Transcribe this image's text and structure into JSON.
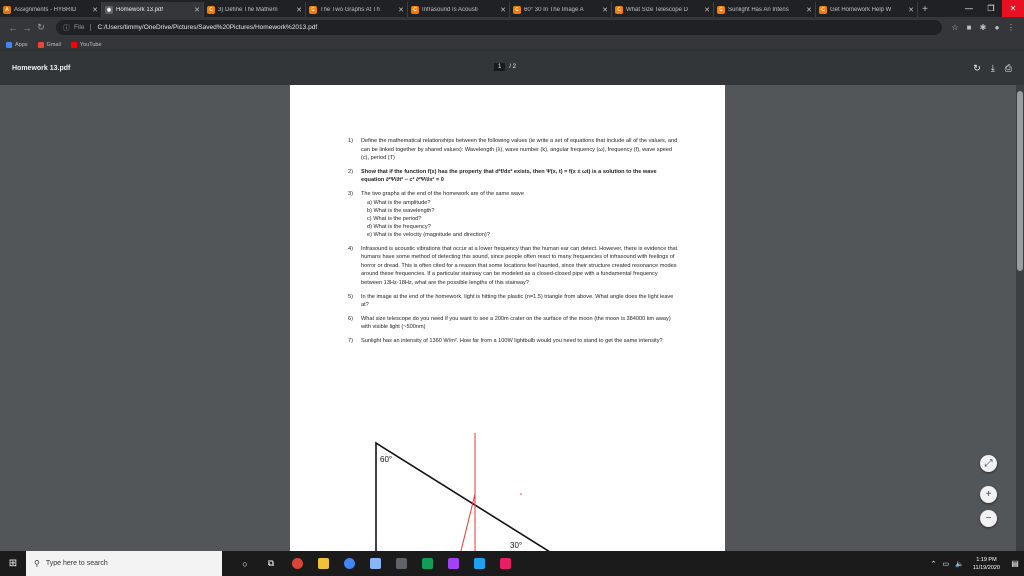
{
  "browser": {
    "tabs": [
      {
        "label": "Assignments - HYBRID",
        "color": "#e37400",
        "glyph": "A",
        "active": false
      },
      {
        "label": "Homework 13.pdf",
        "color": "#5f6368",
        "glyph": "◉",
        "active": true
      },
      {
        "label": "3) Define The Mathem",
        "color": "#f57c00",
        "glyph": "C",
        "active": false
      },
      {
        "label": "The Two Graphs At Th",
        "color": "#f57c00",
        "glyph": "C",
        "active": false
      },
      {
        "label": "Infrasound Is Acousti",
        "color": "#f57c00",
        "glyph": "C",
        "active": false
      },
      {
        "label": "60° 30 In The Image A",
        "color": "#f57c00",
        "glyph": "C",
        "active": false
      },
      {
        "label": "What Size Telescope D",
        "color": "#f57c00",
        "glyph": "C",
        "active": false
      },
      {
        "label": "Sunlight Has An Intens",
        "color": "#f57c00",
        "glyph": "C",
        "active": false
      },
      {
        "label": "Get Homework Help W",
        "color": "#f57c00",
        "glyph": "C",
        "active": false
      }
    ],
    "new_tab": "+",
    "window_controls": {
      "minimize": "—",
      "restore": "❐",
      "close": "✕"
    },
    "address": {
      "scheme": "File",
      "url": "C:/Users/timmy/OneDrive/Pictures/Saved%20Pictures/Homework%2013.pdf"
    },
    "bookmarks": [
      {
        "label": "Apps",
        "color": "#4285f4"
      },
      {
        "label": "Gmail",
        "color": "#ea4335"
      },
      {
        "label": "YouTube",
        "color": "#ff0000"
      }
    ]
  },
  "pdf": {
    "filename": "Homework 13.pdf",
    "page_current": "1",
    "page_total": "/ 2",
    "questions": [
      {
        "n": "1)",
        "text": "Define the mathematical relationships between the following values (ie write a set of equations that include all of the values, and can be linked together by shared values): Wavelength (λ), wave number (k), angular frequency (ω), frequency (f), wave speed (c), period (T)"
      },
      {
        "n": "2)",
        "text": "Show that if the function f(x) has the property that d²f/dx² exists, then Ψ(x, t) = f(x ± ωt) is a solution to the wave equation ∂²Ψ/∂t² − c² ∂²Ψ/∂x² = 0",
        "bold": true
      },
      {
        "n": "3)",
        "text": "The two graphs at the end of the homework are of the same wave",
        "sub": [
          "a)  What is the amplitude?",
          "b)  What is the wavelength?",
          "c)  What is the period?",
          "d)  What is the frequency?",
          "e)  What is the velocity (magnitude and direction)?"
        ]
      },
      {
        "n": "4)",
        "text": "Infrasound is acoustic vibrations that occur at a lower frequency than the human ear can detect. However, there is evidence that humans have some method of detecting this sound, since people often react to many frequencies of infrasound with feelings of horror or dread. This is often cited for a reason that some locations feel haunted, since their structure created resonance modes around these frequencies. If a particular stairway can be modeled as a closed-closed pipe with a fundamental frequency between 13Hz-18Hz, what are the possible lengths of this stairway?"
      },
      {
        "n": "5)",
        "text": "In the image at the end of the homework, light is hitting the plastic (n=1.5) triangle from above. What angle does the light leave at?"
      },
      {
        "n": "6)",
        "text": "What size telescope do you need if you want to see a 200m crater on the surface of the moon (the moon is 384000 km away) with visible light (~500nm)"
      },
      {
        "n": "7)",
        "text": "Sunlight has an intensity of 1360 W/m². How far from a 100W lightbulb would you need to stand to get the same intensity?"
      }
    ],
    "diagram": {
      "angle_top": "60°",
      "angle_bottom": "30°"
    }
  },
  "zoom": {
    "fit": "⤢",
    "in": "+",
    "out": "−"
  },
  "taskbar": {
    "search_placeholder": "Type here to search",
    "time": "1:19 PM",
    "date": "11/19/2020"
  }
}
